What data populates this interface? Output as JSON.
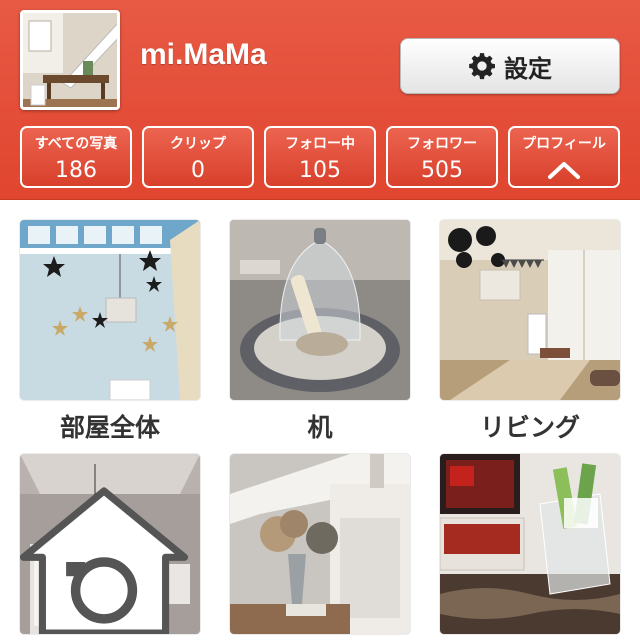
{
  "profile": {
    "username": "mi.MaMa",
    "avatar_icon": "room-photo-avatar"
  },
  "header": {
    "background_color": "#e24a35",
    "settings_label": "設定",
    "settings_icon": "gear-icon"
  },
  "stats": [
    {
      "label": "すべての写真",
      "value": "186"
    },
    {
      "label": "クリップ",
      "value": "0"
    },
    {
      "label": "フォロー中",
      "value": "105"
    },
    {
      "label": "フォロワー",
      "value": "505"
    },
    {
      "label": "プロフィール",
      "icon": "chevron-up-icon"
    }
  ],
  "albums": [
    {
      "caption": "部屋全体"
    },
    {
      "caption": "机"
    },
    {
      "caption": "リビング"
    },
    {
      "caption": "",
      "badge_icon": "home-camera-icon"
    },
    {
      "caption": ""
    },
    {
      "caption": ""
    }
  ]
}
